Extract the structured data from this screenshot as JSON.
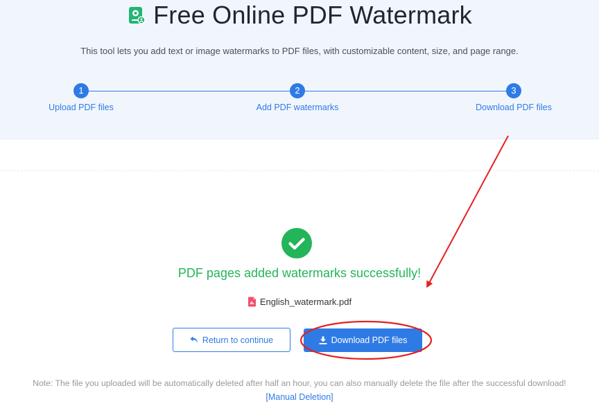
{
  "header": {
    "title": "Free Online PDF Watermark",
    "title_icon": "watermark-document-icon",
    "subtitle": "This tool lets you add text or image watermarks to PDF files, with customizable content, size, and page range."
  },
  "steps": [
    {
      "number": "1",
      "label": "Upload PDF files"
    },
    {
      "number": "2",
      "label": "Add PDF watermarks"
    },
    {
      "number": "3",
      "label": "Download PDF files"
    }
  ],
  "result": {
    "status_icon": "check-circle-icon",
    "message": "PDF pages added watermarks successfully!",
    "file_icon": "pdf-file-icon",
    "file_name": "English_watermark.pdf"
  },
  "actions": {
    "return_label": "Return to continue",
    "return_icon": "undo-arrow-icon",
    "download_label": "Download PDF files",
    "download_icon": "download-icon"
  },
  "footer": {
    "note": "Note: The file you uploaded will be automatically deleted after half an hour, you can also manually delete the file after the successful download!",
    "manual_delete_label": "[Manual Deletion]"
  },
  "colors": {
    "accent": "#2f7be5",
    "success": "#23b559",
    "hero_bg": "#f1f6fd",
    "annotation": "#e52020"
  }
}
